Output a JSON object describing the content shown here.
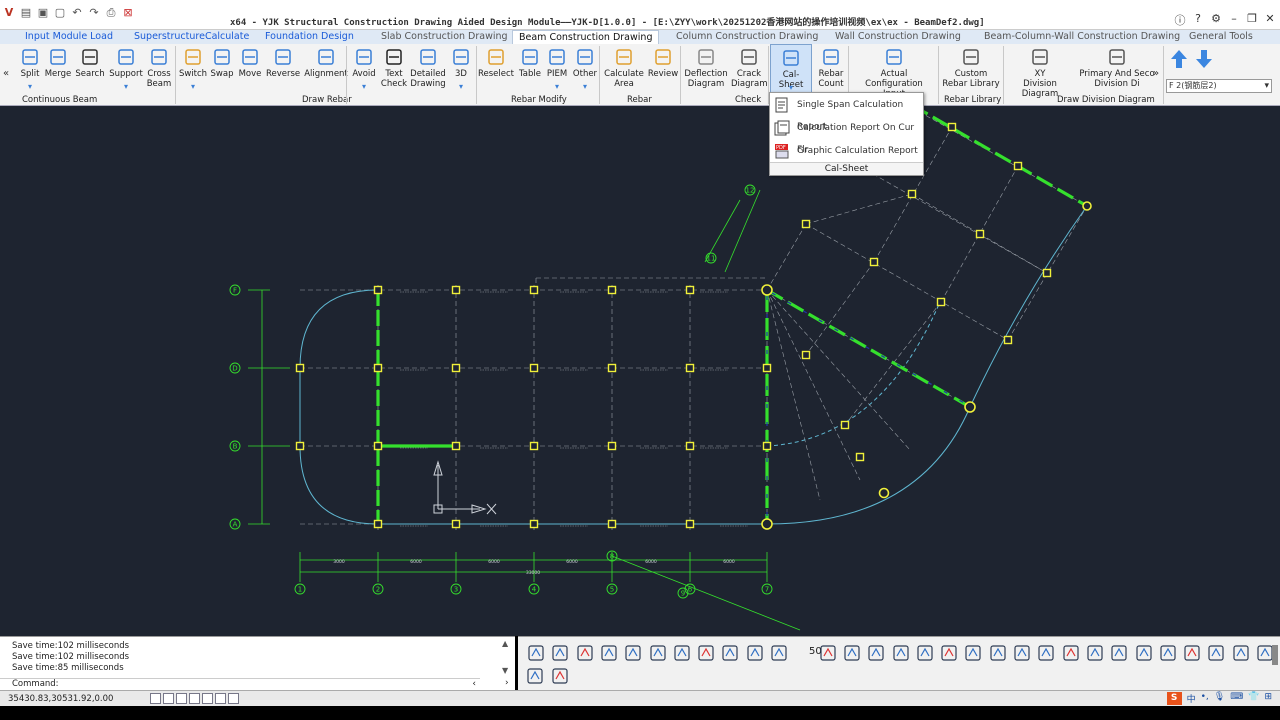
{
  "title": "x64 - YJK Structural Construction Drawing Aided Design Module——YJK-D[1.0.0] - [E:\\ZYY\\work\\20251202香港网站的操作培训视频\\ex\\ex - BeamDef2.dwg]",
  "tabs": [
    {
      "label": "Input Module Load",
      "style": "blue"
    },
    {
      "label": "SuperstructureCalculate",
      "style": "blue"
    },
    {
      "label": "Foundation Design",
      "style": "blue"
    },
    {
      "label": "Slab Construction Drawing",
      "style": "grey"
    },
    {
      "label": "Beam Construction Drawing",
      "style": "active"
    },
    {
      "label": "Column Construction Drawing",
      "style": "grey"
    },
    {
      "label": "Wall Construction Drawing",
      "style": "grey"
    },
    {
      "label": "Beam-Column-Wall Construction Drawing",
      "style": "grey"
    },
    {
      "label": "General Tools",
      "style": "grey"
    }
  ],
  "ribbon": {
    "buttons": [
      {
        "label": "Split",
        "icon": "split-icon",
        "arrow": true
      },
      {
        "label": "Merge",
        "icon": "merge-icon"
      },
      {
        "label": "Search",
        "icon": "search-icon"
      },
      {
        "label": "Support",
        "icon": "support-icon",
        "arrow": true
      },
      {
        "label": "Cross\nBeam",
        "icon": "cross-beam-icon"
      },
      {
        "label": "Switch",
        "icon": "switch-icon",
        "arrow": true
      },
      {
        "label": "Swap",
        "icon": "swap-icon"
      },
      {
        "label": "Move",
        "icon": "move-icon"
      },
      {
        "label": "Reverse",
        "icon": "reverse-icon"
      },
      {
        "label": "Alignment",
        "icon": "alignment-icon"
      },
      {
        "label": "Avoid",
        "icon": "avoid-icon",
        "arrow": true
      },
      {
        "label": "Text\nCheck",
        "icon": "text-check-icon"
      },
      {
        "label": "Detailed\nDrawing",
        "icon": "detailed-drawing-icon"
      },
      {
        "label": "3D",
        "icon": "3d-icon",
        "arrow": true
      },
      {
        "label": "Reselect",
        "icon": "reselect-icon"
      },
      {
        "label": "Table",
        "icon": "table-icon"
      },
      {
        "label": "PIEM",
        "icon": "piem-icon",
        "arrow": true
      },
      {
        "label": "Other",
        "icon": "other-icon",
        "arrow": true
      },
      {
        "label": "Calculate\nArea",
        "icon": "calculate-area-icon"
      },
      {
        "label": "Review",
        "icon": "review-icon"
      },
      {
        "label": "Deflection\nDiagram",
        "icon": "deflection-diagram-icon"
      },
      {
        "label": "Crack\nDiagram",
        "icon": "crack-diagram-icon"
      },
      {
        "label": "Cal-Sheet",
        "icon": "cal-sheet-icon",
        "arrow": true
      },
      {
        "label": "Rebar\nCount",
        "icon": "rebar-count-icon"
      },
      {
        "label": "Actual Configuration\nInput",
        "icon": "actual-config-icon"
      },
      {
        "label": "Custom\nRebar Library",
        "icon": "custom-rebar-library-icon"
      },
      {
        "label": "XY\nDivision Diagram",
        "icon": "xy-division-icon"
      },
      {
        "label": "Primary And Seco\nDivision Di",
        "icon": "primary-division-icon"
      }
    ],
    "groups": [
      "Continuous Beam",
      "Draw Rebar",
      "Rebar Modify",
      "Rebar",
      "Check",
      "Rebar Library",
      "Draw Division Diagram"
    ],
    "floor_select": "F 2(钢筋层2)"
  },
  "dropdown": {
    "items": [
      {
        "label": "Single Span Calculation  Report",
        "icon": "single-span-report-icon"
      },
      {
        "label": "Calculation Report On Cur Flr",
        "icon": "floor-report-icon"
      },
      {
        "label": "Graphic Calculation Report",
        "icon": "pdf-report-icon"
      }
    ],
    "footer": "Cal-Sheet"
  },
  "drawing": {
    "axis_labels_bottom": [
      "1",
      "2",
      "3",
      "4",
      "5",
      "6",
      "7"
    ],
    "axis_labels_left": [
      "F",
      "D",
      "B",
      "A"
    ],
    "dim_labels": [
      "3000",
      "6000",
      "6000",
      "6000",
      "6000",
      "6000",
      "33000"
    ],
    "axis_labels_rotated": [
      "12",
      "11",
      "8",
      "9"
    ]
  },
  "command": {
    "history": [
      "Save time:102 milliseconds",
      "Save time:102 milliseconds",
      "Save time:85 milliseconds"
    ],
    "prompt": "Command:"
  },
  "status": {
    "coords": "35430.83,30531.92,0.00",
    "zoom_value": "50"
  }
}
